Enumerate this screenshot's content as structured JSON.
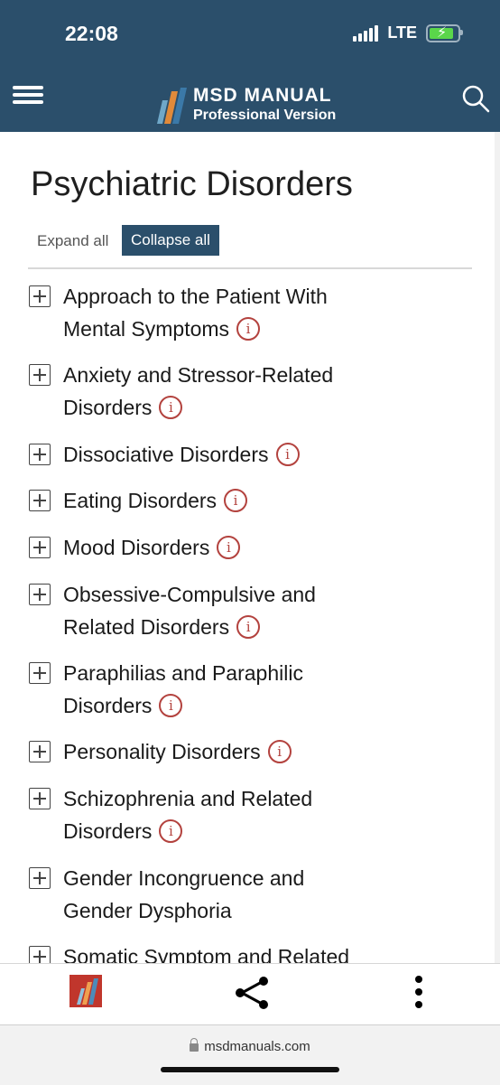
{
  "status_bar": {
    "time": "22:08",
    "network": "LTE"
  },
  "header": {
    "brand_title": "MSD MANUAL",
    "brand_subtitle": "Professional Version",
    "accent_color": "#2b4f6b"
  },
  "page": {
    "title": "Psychiatric Disorders",
    "expand_all_label": "Expand all",
    "collapse_all_label": "Collapse all"
  },
  "topics": [
    {
      "line1": "Approach to the Patient With",
      "line2": "Mental Symptoms",
      "info": true
    },
    {
      "line1": "Anxiety and Stressor-Related",
      "line2": "Disorders",
      "info": true
    },
    {
      "line1": "Dissociative Disorders",
      "line2": "",
      "info": true
    },
    {
      "line1": "Eating Disorders",
      "line2": "",
      "info": true
    },
    {
      "line1": "Mood Disorders",
      "line2": "",
      "info": true
    },
    {
      "line1": "Obsessive-Compulsive and",
      "line2": "Related Disorders",
      "info": true
    },
    {
      "line1": "Paraphilias and Paraphilic",
      "line2": "Disorders",
      "info": true
    },
    {
      "line1": "Personality Disorders",
      "line2": "",
      "info": true
    },
    {
      "line1": "Schizophrenia and Related",
      "line2": "Disorders",
      "info": true
    },
    {
      "line1": "Gender Incongruence and",
      "line2": "Gender Dysphoria",
      "info": false
    },
    {
      "line1": "Somatic Symptom and Related",
      "line2": "",
      "info": false
    }
  ],
  "icons": {
    "menu": "hamburger-icon",
    "search": "search-icon",
    "expand": "plus-box-icon",
    "info": "info-circle-icon",
    "share": "share-icon",
    "more": "more-vertical-icon",
    "lock": "lock-icon"
  },
  "info_icon_glyph": "i",
  "browser": {
    "url": "msdmanuals.com"
  }
}
